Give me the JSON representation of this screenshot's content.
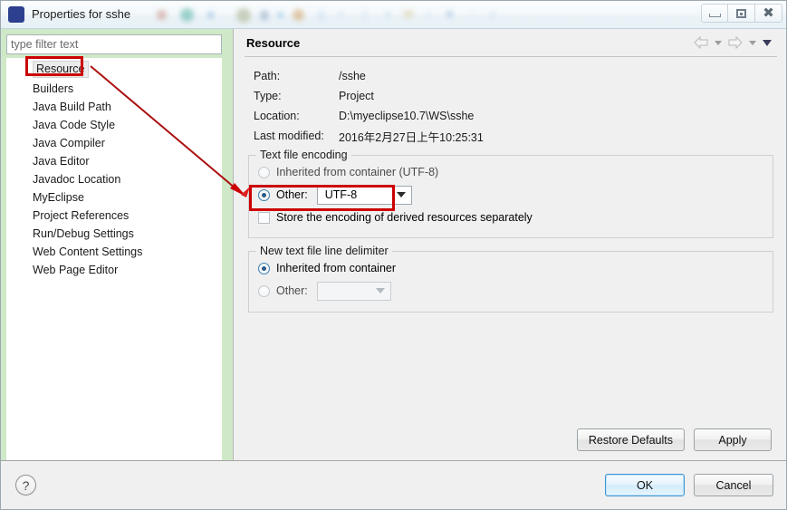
{
  "window": {
    "title": "Properties for sshe",
    "icon": "eclipse-icon",
    "controls": [
      {
        "name": "minimize-button",
        "glyph": "minimize-icon"
      },
      {
        "name": "maximize-button",
        "glyph": "maximize-icon"
      },
      {
        "name": "close-button",
        "glyph": "close-icon",
        "label": "✖"
      }
    ]
  },
  "sidebar": {
    "filter": {
      "placeholder": "type filter text",
      "value": "type filter text"
    },
    "items": [
      {
        "label": "Resource",
        "selected": true
      },
      {
        "label": "Builders",
        "selected": false
      },
      {
        "label": "Java Build Path",
        "selected": false
      },
      {
        "label": "Java Code Style",
        "selected": false
      },
      {
        "label": "Java Compiler",
        "selected": false
      },
      {
        "label": "Java Editor",
        "selected": false
      },
      {
        "label": "Javadoc Location",
        "selected": false
      },
      {
        "label": "MyEclipse",
        "selected": false
      },
      {
        "label": "Project References",
        "selected": false
      },
      {
        "label": "Run/Debug Settings",
        "selected": false
      },
      {
        "label": "Web Content Settings",
        "selected": false
      },
      {
        "label": "Web Page Editor",
        "selected": false
      }
    ]
  },
  "page": {
    "title": "Resource",
    "nav": {
      "back_icon": "back-arrow-icon",
      "back_menu_icon": "chevron-down-icon",
      "forward_icon": "forward-arrow-icon",
      "forward_menu_icon": "chevron-down-icon",
      "menu_icon": "view-menu-icon"
    },
    "properties": [
      {
        "label": "Path:",
        "value": "/sshe"
      },
      {
        "label": "Type:",
        "value": "Project"
      },
      {
        "label": "Location:",
        "value": "D:\\myeclipse10.7\\WS\\sshe"
      },
      {
        "label": "Last modified:",
        "value": "2016年2月27日上午10:25:31"
      }
    ],
    "encoding_group": {
      "title": "Text file encoding",
      "inherited_label": "Inherited from container (UTF-8)",
      "inherited_selected": false,
      "other_label": "Other:",
      "other_selected": true,
      "other_value": "UTF-8",
      "store_derived_label": "Store the encoding of derived resources separately",
      "store_derived_checked": false
    },
    "delimiter_group": {
      "title": "New text file line delimiter",
      "inherited_label": "Inherited from container",
      "inherited_selected": true,
      "other_label": "Other:",
      "other_selected": false,
      "other_value": ""
    },
    "actions": {
      "restore_defaults": "Restore Defaults",
      "apply": "Apply"
    }
  },
  "footer": {
    "help_icon": "help-icon",
    "help_glyph": "?",
    "ok": "OK",
    "cancel": "Cancel"
  },
  "annotations": {
    "accent_color": "#cc0000",
    "box_resource": "highlight-resource-tree-item",
    "box_other_encoding": "highlight-other-encoding-row",
    "arrow": "red-arrow-resource-to-encoding"
  }
}
